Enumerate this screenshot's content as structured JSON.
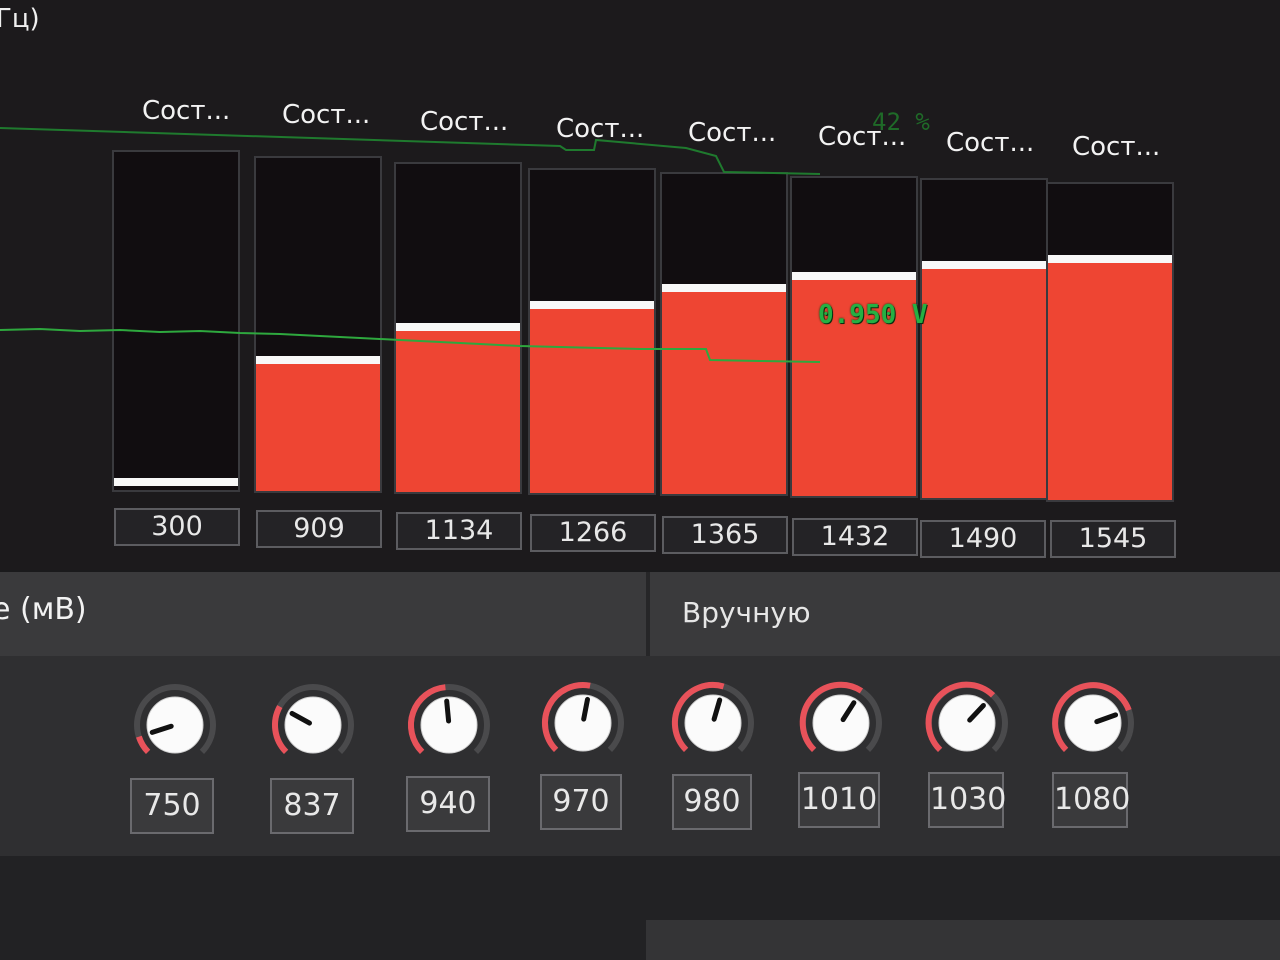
{
  "frequency_section": {
    "unit_label": "Гц)",
    "state_label": "Сост...",
    "percent_readout": "42 %",
    "voltage_readout": "0.950 V",
    "states": [
      {
        "label": "Сост...",
        "frequency": "300",
        "fill": 0.0
      },
      {
        "label": "Сост...",
        "frequency": "909",
        "fill": 0.38
      },
      {
        "label": "Сост...",
        "frequency": "1134",
        "fill": 0.49
      },
      {
        "label": "Сост...",
        "frequency": "1266",
        "fill": 0.57
      },
      {
        "label": "Сост...",
        "frequency": "1365",
        "fill": 0.63
      },
      {
        "label": "Сост...",
        "frequency": "1432",
        "fill": 0.68
      },
      {
        "label": "Сост...",
        "frequency": "1490",
        "fill": 0.72
      },
      {
        "label": "Сост...",
        "frequency": "1545",
        "fill": 0.75
      }
    ]
  },
  "voltage_section": {
    "title": "e (мВ)",
    "mode": "Вручную",
    "knobs": [
      {
        "value": "750"
      },
      {
        "value": "837"
      },
      {
        "value": "940"
      },
      {
        "value": "970"
      },
      {
        "value": "980"
      },
      {
        "value": "1010"
      },
      {
        "value": "1030"
      },
      {
        "value": "1080"
      }
    ]
  },
  "colors": {
    "bar_fill": "#ee4533",
    "bar_cap": "#f8f8f8",
    "knob_active": "#e8525a",
    "knob_track": "#4a4a4c",
    "monitor_line": "#2aa040"
  }
}
